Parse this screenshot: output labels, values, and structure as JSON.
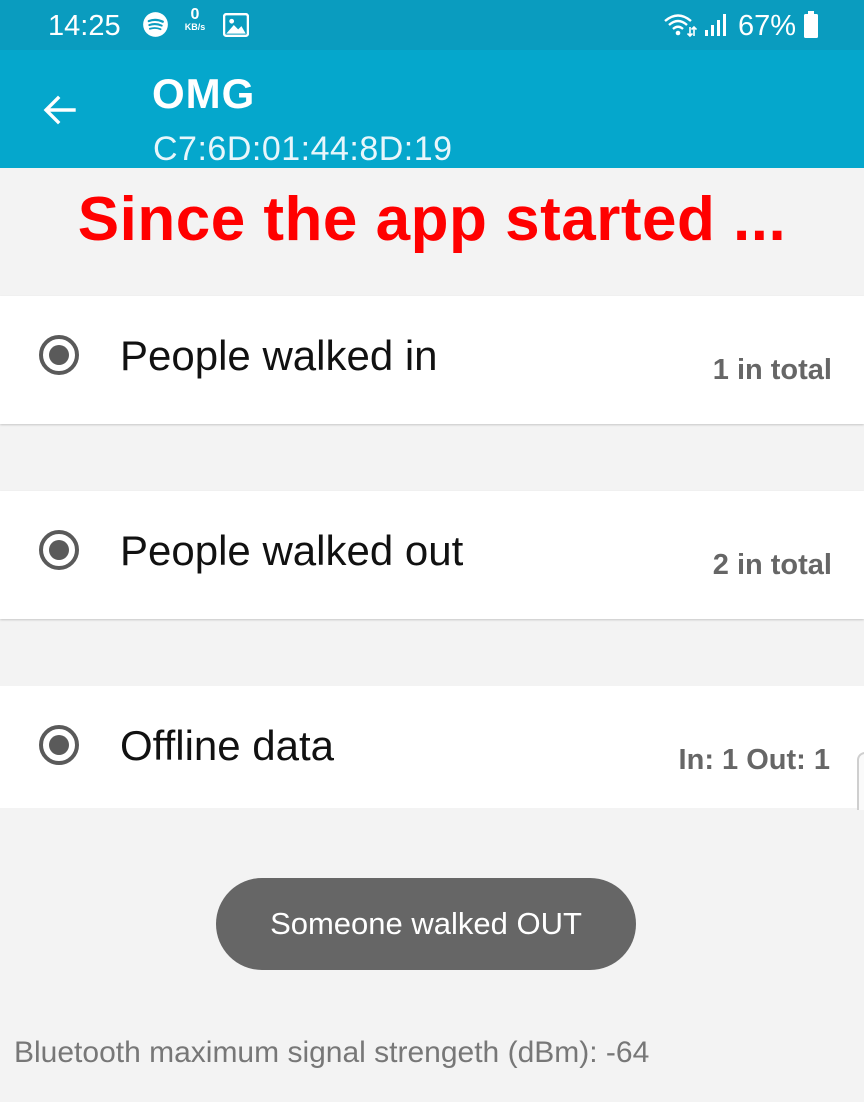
{
  "status_bar": {
    "time": "14:25",
    "kbs_value": "0",
    "kbs_unit": "KB/s",
    "battery": "67%",
    "icons": [
      "spotify-icon",
      "image-icon",
      "wifi-icon",
      "signal-icon",
      "battery-icon"
    ]
  },
  "app_bar": {
    "title": "OMG",
    "subtitle": "C7:6D:01:44:8D:19",
    "back_icon": "arrow-left-icon",
    "color": "#05a7cc"
  },
  "headline": "Since the app started ...",
  "cards": [
    {
      "label": "People walked in",
      "value": "1 in total"
    },
    {
      "label": "People walked out",
      "value": "2 in total"
    },
    {
      "label": "Offline data",
      "value": "In: 1 Out: 1"
    }
  ],
  "toast": "Someone walked OUT",
  "footer": "Bluetooth maximum signal strengeth (dBm): -64",
  "colors": {
    "status_bar": "#0a9cbf",
    "headline": "#ff0000",
    "toast": "#666666",
    "background": "#f3f3f3"
  }
}
